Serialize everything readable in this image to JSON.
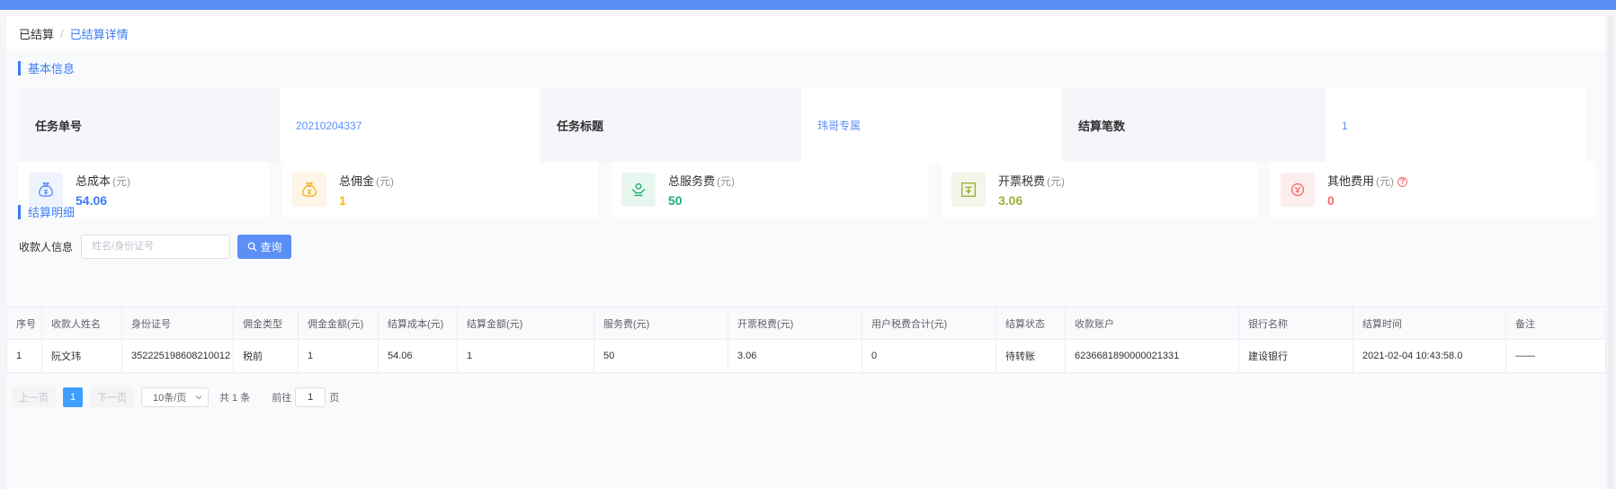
{
  "breadcrumb": {
    "parent": "已结算",
    "separator": "/",
    "current": "已结算详情"
  },
  "basic_section": {
    "title": "基本信息"
  },
  "basic_info": [
    {
      "label": "任务单号",
      "value": "20210204337"
    },
    {
      "label": "任务标题",
      "value": "玮哥专属"
    },
    {
      "label": "结算笔数",
      "value": "1"
    }
  ],
  "stats": [
    {
      "title": "总成本",
      "unit": "(元)",
      "value": "54.06",
      "color": "#3a7bf4",
      "icon": "money-bag-icon",
      "icon_bg": "#eef3fe"
    },
    {
      "title": "总佣金",
      "unit": "(元)",
      "value": "1",
      "color": "#f5b322",
      "icon": "money-bag-icon",
      "icon_bg": "#fdf6e6"
    },
    {
      "title": "总服务费",
      "unit": "(元)",
      "value": "50",
      "color": "#1fae72",
      "icon": "hand-coin-icon",
      "icon_bg": "#e8f6f0"
    },
    {
      "title": "开票税费",
      "unit": "(元)",
      "value": "3.06",
      "color": "#9bb13a",
      "icon": "tax-stamp-icon",
      "icon_bg": "#f3f6e8"
    },
    {
      "title": "其他费用",
      "unit": "(元)",
      "value": "0",
      "color": "#f56c6c",
      "icon": "coin-icon",
      "icon_bg": "#fdeeee",
      "help": "?"
    }
  ],
  "detail_section": {
    "title": "结算明细"
  },
  "filter": {
    "label": "收款人信息",
    "placeholder": "姓名/身份证号",
    "button": "查询"
  },
  "table": {
    "columns": [
      "序号",
      "收款人姓名",
      "身份证号",
      "佣金类型",
      "佣金金额(元)",
      "结算成本(元)",
      "结算金额(元)",
      "服务费(元)",
      "开票税费(元)",
      "用户税费合计(元)",
      "结算状态",
      "收款账户",
      "银行名称",
      "结算时间",
      "备注"
    ],
    "rows": [
      [
        "1",
        "阮文玮",
        "352225198608210012",
        "税前",
        "1",
        "54.06",
        "1",
        "50",
        "3.06",
        "0",
        "待转账",
        "6236681890000021331",
        "建设银行",
        "2021-02-04 10:43:58.0",
        "——"
      ]
    ]
  },
  "pagination": {
    "prev": "上一页",
    "current": "1",
    "next": "下一页",
    "page_size": "10条/页",
    "total": "共 1 条",
    "goto_prefix": "前往",
    "goto_value": "1",
    "goto_suffix": "页"
  }
}
